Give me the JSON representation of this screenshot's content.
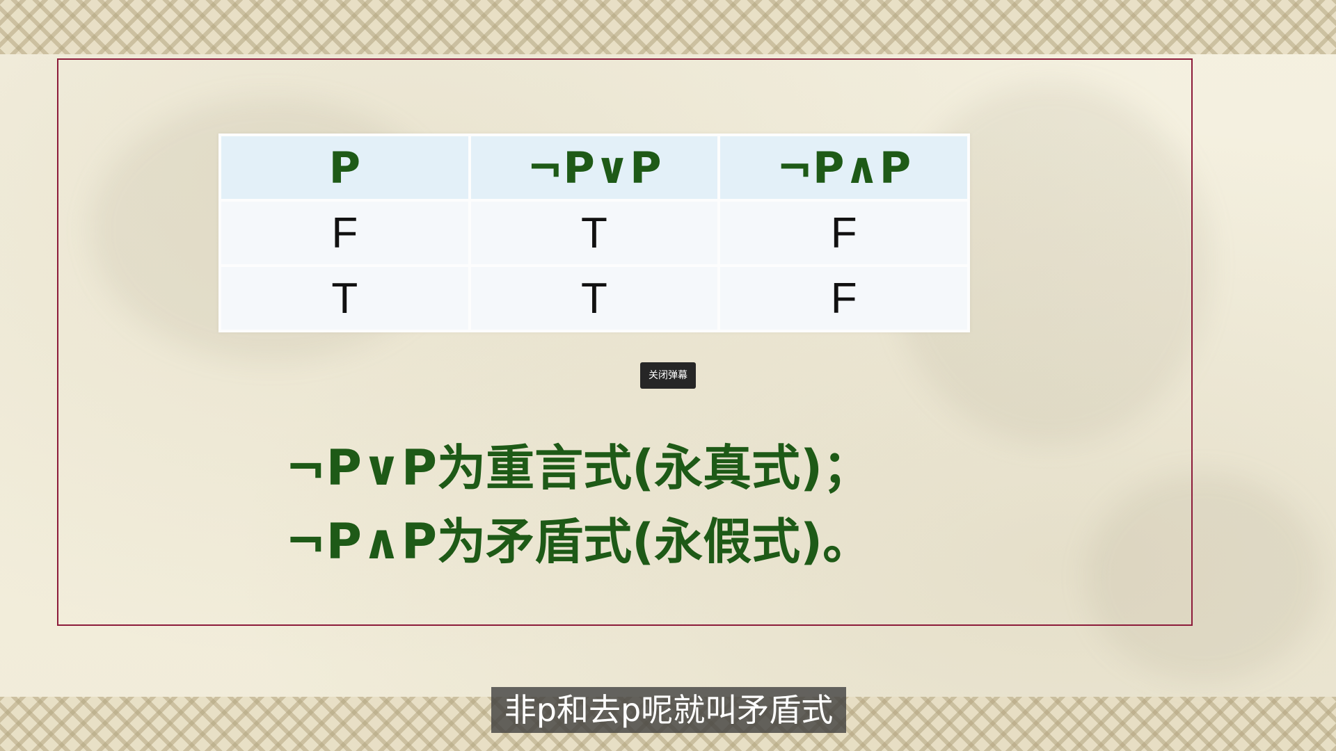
{
  "table": {
    "headers": [
      "P",
      "¬P∨P",
      "¬P∧P"
    ],
    "rows": [
      [
        "F",
        "T",
        "F"
      ],
      [
        "T",
        "T",
        "F"
      ]
    ]
  },
  "danmaku_button": {
    "label": "关闭弹幕"
  },
  "conclusions": [
    "¬P∨P为重言式(永真式)；",
    "¬P∧P为矛盾式(永假式)。"
  ],
  "subtitle": "非p和去p呢就叫矛盾式",
  "colors": {
    "frame_border": "#8c1b3a",
    "heading_green": "#1e5a17",
    "table_header_bg": "#e3f0f8",
    "subtitle_bg": "#3c3c3c"
  }
}
